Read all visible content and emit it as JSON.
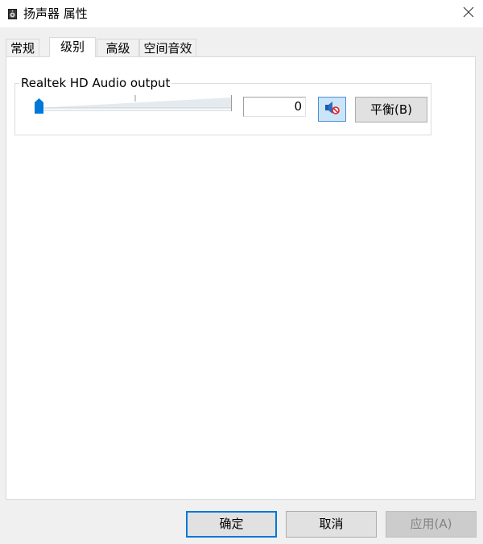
{
  "window": {
    "title": "扬声器 属性",
    "title_icon": "speaker-device-icon",
    "close_icon": "close-icon"
  },
  "tabs": [
    {
      "label": "常规",
      "active": false
    },
    {
      "label": "级别",
      "active": true
    },
    {
      "label": "高级",
      "active": false
    },
    {
      "label": "空间音效",
      "active": false
    }
  ],
  "levels": {
    "group_label": "Realtek HD Audio output",
    "volume_value": "0",
    "volume_level": 0,
    "mute_icon": "speaker-muted-icon",
    "balance_label": "平衡(B)"
  },
  "footer": {
    "ok_label": "确定",
    "cancel_label": "取消",
    "apply_label": "应用(A)"
  },
  "colors": {
    "accent": "#0078d7",
    "slider_thumb": "#0078d7",
    "mute_button_bg": "#cce4f7"
  }
}
